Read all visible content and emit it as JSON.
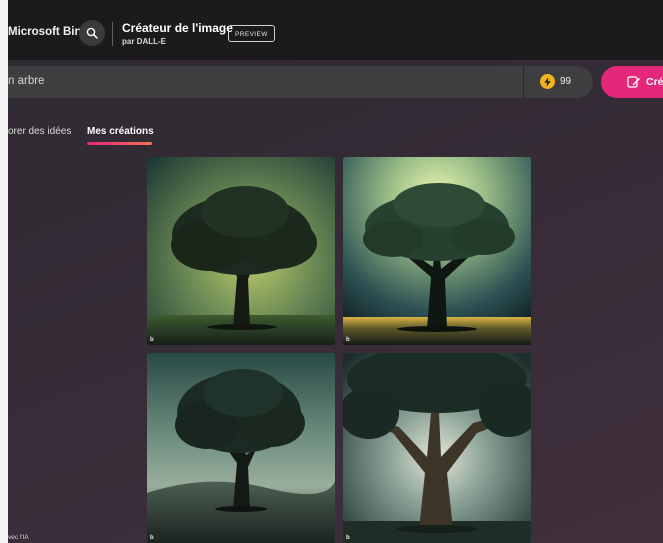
{
  "header": {
    "brand": "Microsoft Bing",
    "title": "Créateur de l'image",
    "subtitle": "par DALL-E",
    "badge": "PREVIEW"
  },
  "prompt": {
    "value": "n arbre"
  },
  "boosts": {
    "count": "99"
  },
  "create_button": {
    "label": "Créer"
  },
  "tabs": [
    {
      "label": "orer des idées",
      "active": false
    },
    {
      "label": "Mes créations",
      "active": true
    }
  ],
  "images": [
    {
      "watermark": "b"
    },
    {
      "watermark": "b"
    },
    {
      "watermark": "b"
    },
    {
      "watermark": "b"
    }
  ],
  "footer": {
    "note": "vec l'IA"
  },
  "colors": {
    "accent": "#e3277b",
    "boost": "#f2b41b",
    "header_bg": "#1b1a1c",
    "prompt_bg": "#3e3d40"
  },
  "icons": {
    "search": "search-icon",
    "boost": "lightning-icon",
    "create": "create-image-icon"
  }
}
